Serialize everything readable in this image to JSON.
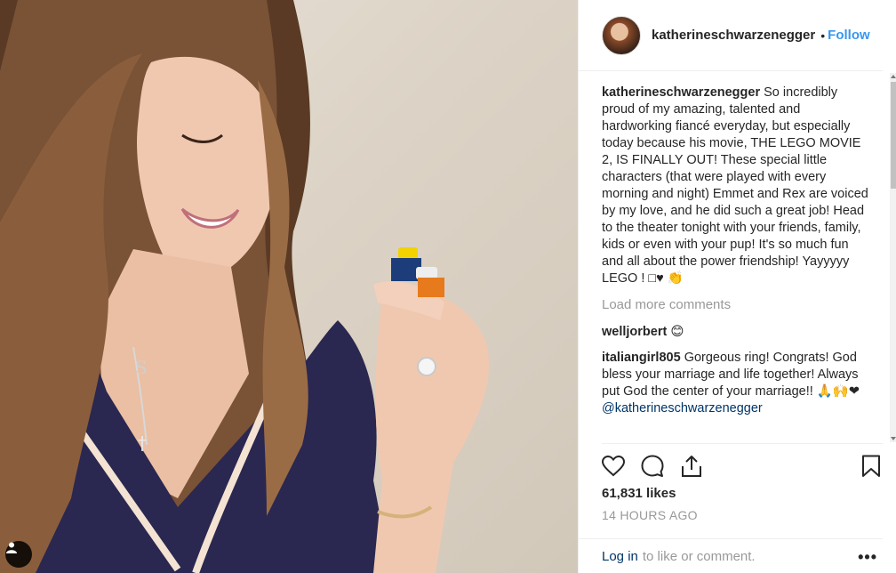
{
  "post": {
    "username": "katherineschwarzenegger",
    "follow_label": "Follow",
    "caption": "So incredibly proud of my amazing, talented and hardworking fiancé everyday, but especially today because his movie, THE LEGO MOVIE 2, IS FINALLY OUT! These special little characters (that were played with every morning and night) Emmet and Rex are voiced by my love, and he did such a great job! Head to the theater tonight with your friends, family, kids or even with your pup! It's so much fun and all about the power friendship! Yayyyyy LEGO ! □♥ 👏",
    "load_more_label": "Load more comments",
    "likes": "61,831 likes",
    "time_ago": "14 HOURS AGO"
  },
  "comments": [
    {
      "user": "welljorbert",
      "text": "😊"
    },
    {
      "user": "italiangirl805",
      "text": "Gorgeous ring! Congrats! God bless your marriage and life together! Always put God the center of your marriage!! 🙏🙌❤",
      "mention": "@katherineschwarzenegger"
    }
  ],
  "footer": {
    "login_label": "Log in",
    "login_rest": "to like or comment.",
    "more_label": "•••"
  },
  "icons": {
    "like": "heart-icon",
    "comment": "comment-icon",
    "share": "share-icon",
    "save": "bookmark-icon",
    "user_tag": "user-tag-icon"
  },
  "colors": {
    "link_blue": "#3897f0",
    "text_dark": "#262626",
    "text_muted": "#999999",
    "mention": "#003569"
  }
}
